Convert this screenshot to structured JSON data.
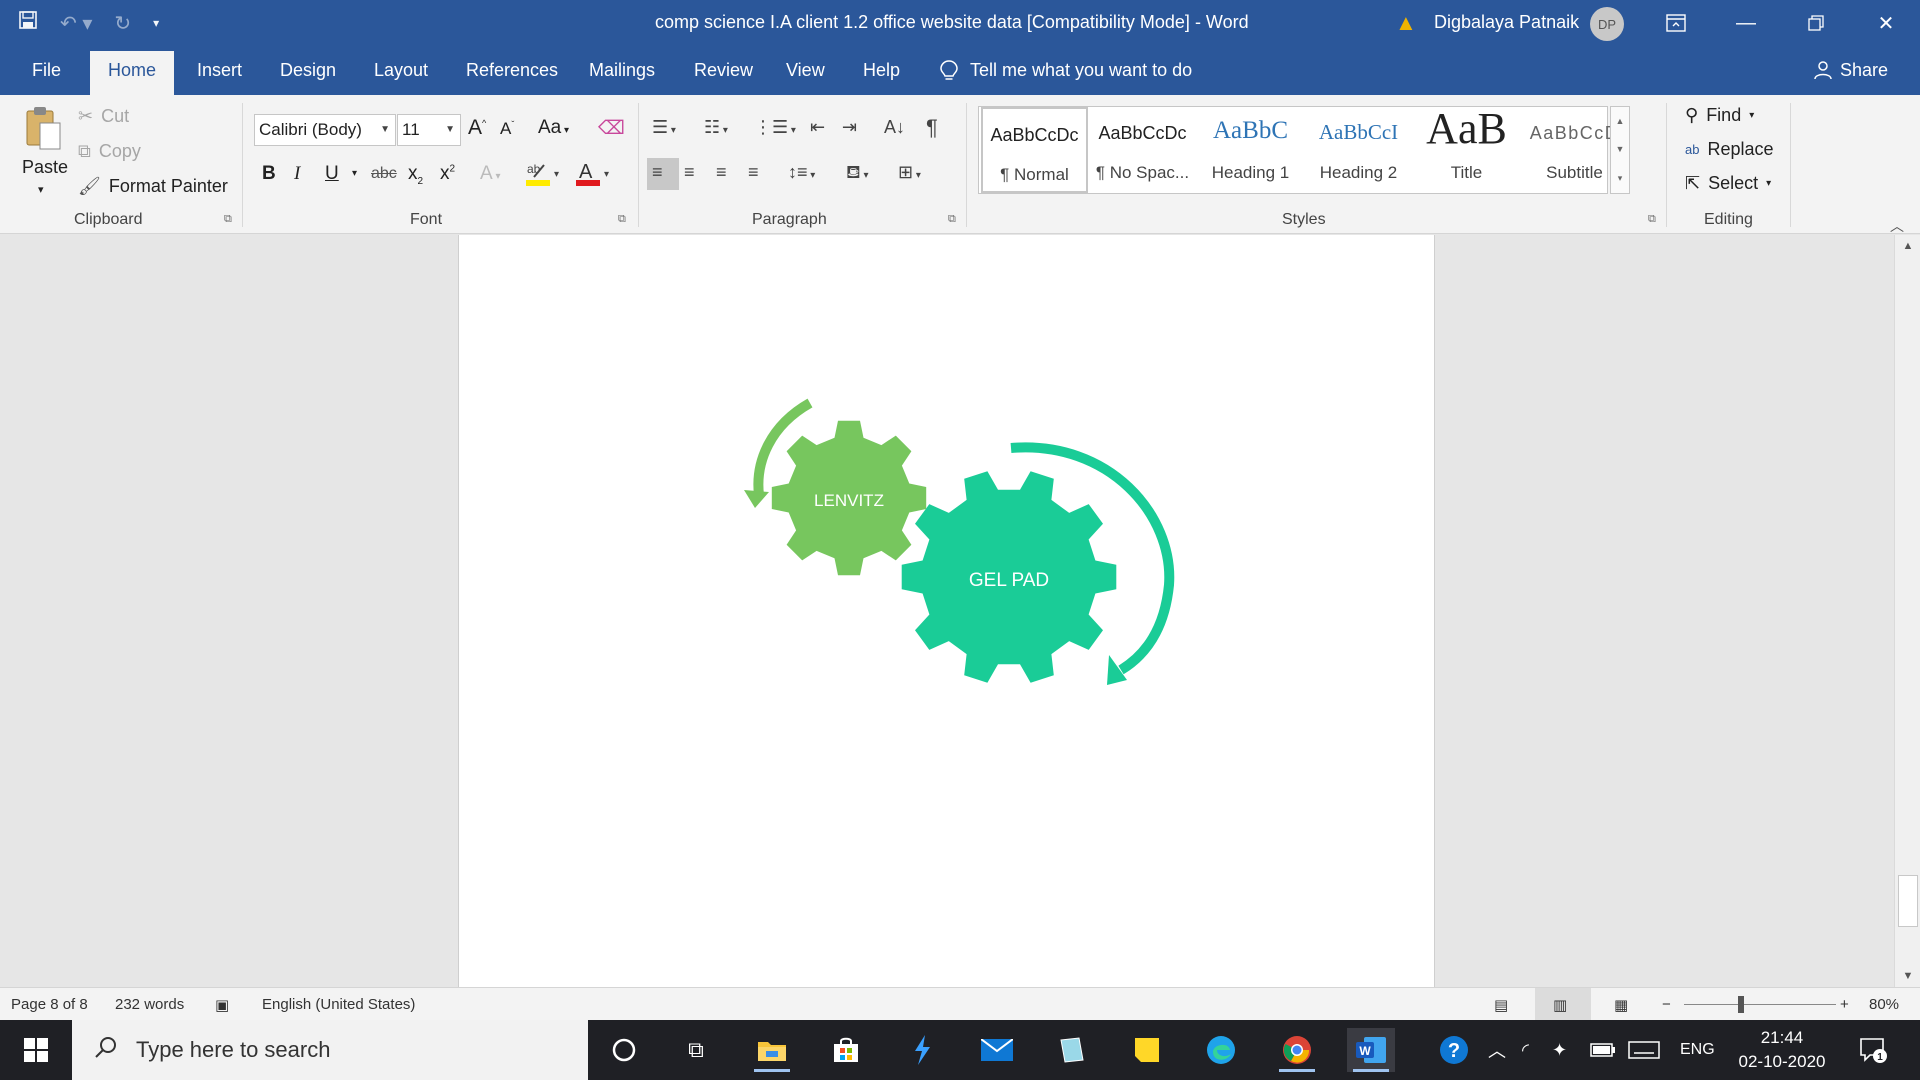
{
  "window": {
    "title": "comp science I.A client 1.2 office website data [Compatibility Mode]  -  Word",
    "user_name": "Digbalaya Patnaik",
    "user_initials": "DP"
  },
  "qat": {
    "save_icon": "save-icon",
    "undo_icon": "undo-icon",
    "redo_icon": "redo-icon",
    "customize_icon": "chevron-down-icon"
  },
  "tabs": [
    {
      "label": "File"
    },
    {
      "label": "Home"
    },
    {
      "label": "Insert"
    },
    {
      "label": "Design"
    },
    {
      "label": "Layout"
    },
    {
      "label": "References"
    },
    {
      "label": "Mailings"
    },
    {
      "label": "Review"
    },
    {
      "label": "View"
    },
    {
      "label": "Help"
    }
  ],
  "tellme": {
    "label": "Tell me what you want to do"
  },
  "share": {
    "label": "Share"
  },
  "clipboard": {
    "paste": "Paste",
    "cut": "Cut",
    "copy": "Copy",
    "format_painter": "Format Painter",
    "group_label": "Clipboard"
  },
  "font": {
    "font_name": "Calibri (Body)",
    "font_size": "11",
    "grow": "A",
    "shrink": "A",
    "change_case": "Aa",
    "bold": "B",
    "italic": "I",
    "underline": "U",
    "strike": "abc",
    "subscript": "x",
    "superscript": "x",
    "group_label": "Font"
  },
  "paragraph": {
    "group_label": "Paragraph"
  },
  "styles": {
    "items": [
      {
        "sample": "AaBbCcDc",
        "name": "¶ Normal"
      },
      {
        "sample": "AaBbCcDc",
        "name": "¶ No Spac..."
      },
      {
        "sample": "AaBbC",
        "name": "Heading 1"
      },
      {
        "sample": "AaBbCcI",
        "name": "Heading 2"
      },
      {
        "sample": "AaB",
        "name": "Title"
      },
      {
        "sample": "AaBbCcD",
        "name": "Subtitle"
      }
    ],
    "group_label": "Styles"
  },
  "editing": {
    "find": "Find",
    "replace": "Replace",
    "select": "Select",
    "group_label": "Editing"
  },
  "document": {
    "gear_small_label": "LENVITZ",
    "gear_large_label": "GEL PAD",
    "gear_small_color": "#77c65e",
    "gear_large_color": "#1acc97"
  },
  "statusbar": {
    "page": "Page 8 of 8",
    "words": "232 words",
    "language": "English (United States)",
    "zoom": "80%"
  },
  "taskbar": {
    "search_placeholder": "Type here to search",
    "lang": "ENG",
    "time": "21:44",
    "date": "02-10-2020",
    "notification_count": "1"
  },
  "colors": {
    "word_blue": "#2b579a",
    "ribbon_bg": "#f3f3f3",
    "doc_bg": "#e6e6e6"
  }
}
